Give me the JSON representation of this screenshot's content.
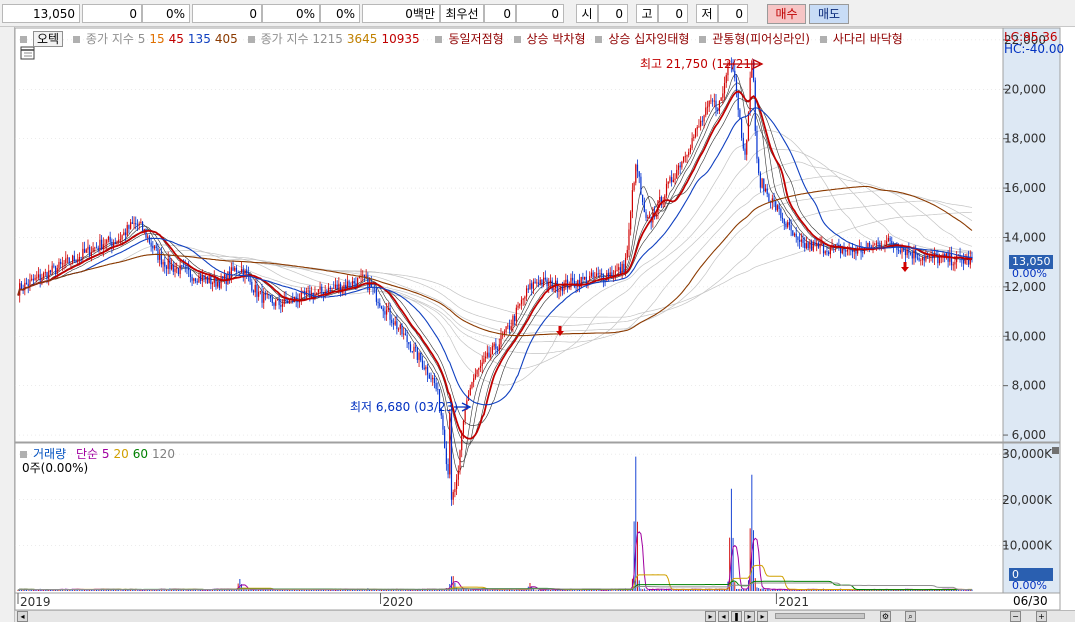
{
  "topbar": {
    "price": "13,050",
    "change": "0",
    "change_pct": "0%",
    "f1": "0",
    "f1_pct": "0%",
    "f2_pct": "0%",
    "vol_text": "0백만",
    "best_label": "최우선",
    "best_ask": "0",
    "best_bid": "0",
    "open_label": "시",
    "open": "0",
    "high_label": "고",
    "high": "0",
    "low_label": "저",
    "low": "0",
    "buy_label": "매수",
    "sell_label": "매도"
  },
  "legend_price": {
    "ticker": "오텍",
    "ma_label": "종가 지수 5",
    "ma15": "15",
    "ma45": "45",
    "ma135": "135",
    "ma405": "405",
    "ma_label2": "종가 지수 1215",
    "ma3645": "3645",
    "ma10935": "10935",
    "pattern1": "동일저점형",
    "pattern2": "상승 박차형",
    "pattern3": "상승 십자잉태형",
    "pattern4": "관통형(피어싱라인)",
    "pattern5": "사다리 바닥형"
  },
  "legend_vol": {
    "label": "거래량",
    "ma_label": "단순 5",
    "ma20": "20",
    "ma60": "60",
    "ma120": "120",
    "stat": "0주(0.00%)"
  },
  "right_tags": {
    "lc": "LC:95.36",
    "hc": "HC:-40.00",
    "price": "13,050",
    "price_pct": "0.00%",
    "vol": "0",
    "vol_pct": "0.00%"
  },
  "annotations": {
    "high": "최고 21,750 (12/21)",
    "low": "최저 6,680 (03/23)"
  },
  "bottom": {
    "date_right": "06/30"
  },
  "colors": {
    "candle_up": "#d00000",
    "candle_down": "#0030d0",
    "ma_main": "#c00000",
    "ma_blue": "#1040c0",
    "ma_long": "#8b3a00",
    "grid": "#d8d8d8"
  },
  "chart_data": [
    {
      "type": "line",
      "title": "",
      "ylabel": "",
      "x": [
        "2019",
        "2019-04",
        "2019-07",
        "2019-10",
        "2020",
        "2020-03",
        "2020-06",
        "2020-09",
        "2020-12",
        "2021",
        "2021-04",
        "2021-06"
      ],
      "series": [
        {
          "values": [
            11900,
            13800,
            12500,
            11300,
            12300,
            7200,
            11800,
            12700,
            19500,
            13700,
            13300,
            13050
          ]
        }
      ],
      "y_ticks": [
        "22,000",
        "20,000",
        "18,000",
        "16,000",
        "14,000",
        "12,000",
        "10,000",
        "8,000",
        "6,000"
      ],
      "ylim": [
        5800,
        22400
      ],
      "x_tick_labels": [
        "2019",
        "2020",
        "2021"
      ]
    },
    {
      "type": "bar",
      "title": "",
      "ylabel": "",
      "y_ticks": [
        "30,000K",
        "20,000K",
        "10,000K"
      ],
      "ylim": [
        0,
        32000
      ],
      "x_tick_labels": [
        "2019",
        "2020",
        "2021"
      ]
    }
  ]
}
